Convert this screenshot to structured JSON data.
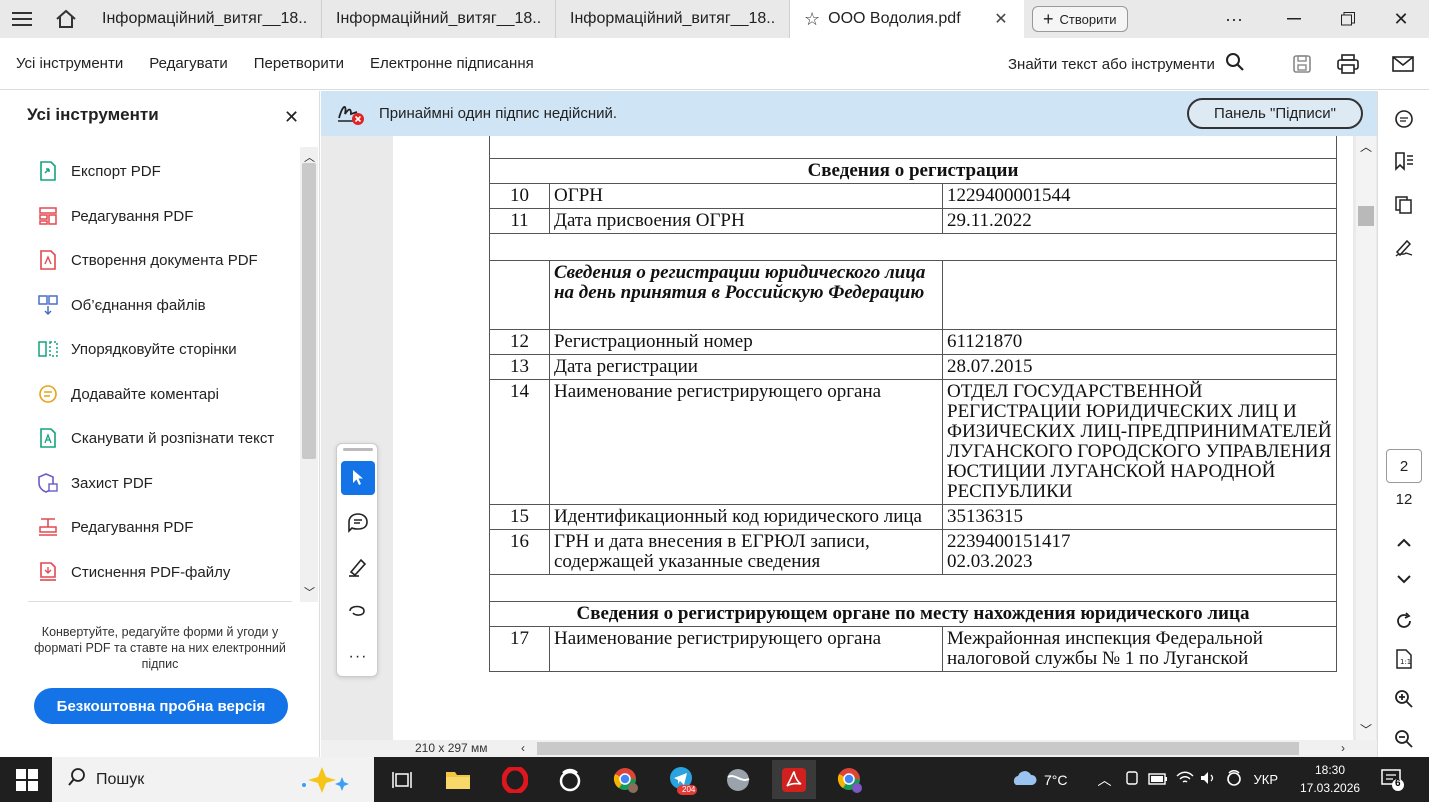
{
  "tabs": [
    {
      "label": "Інформаційний_витяг__18..."
    },
    {
      "label": "Інформаційний_витяг__18..."
    },
    {
      "label": "Інформаційний_витяг__18..."
    },
    {
      "label": "ООО Водолия.pdf",
      "active": true
    }
  ],
  "create_label": "Створити",
  "more_label": "···",
  "menu": {
    "items": [
      "Усі інструменти",
      "Редагувати",
      "Перетворити",
      "Електронне підписання"
    ],
    "find": "Знайти текст або інструменти"
  },
  "left_panel": {
    "title": "Усі інструменти",
    "tools": [
      {
        "label": "Експорт PDF",
        "icon": "export-pdf-icon",
        "color": "#14a37f"
      },
      {
        "label": "Редагування PDF",
        "icon": "edit-pdf-icon",
        "color": "#e34850"
      },
      {
        "label": "Створення документа PDF",
        "icon": "create-pdf-icon",
        "color": "#e34850"
      },
      {
        "label": "Об’єднання файлів",
        "icon": "combine-files-icon",
        "color": "#4b6ec9"
      },
      {
        "label": "Упорядковуйте сторінки",
        "icon": "organize-pages-icon",
        "color": "#14a37f"
      },
      {
        "label": "Додавайте коментарі",
        "icon": "comment-icon",
        "color": "#e8a317"
      },
      {
        "label": "Сканувати й розпізнати текст",
        "icon": "scan-ocr-icon",
        "color": "#14a37f"
      },
      {
        "label": "Захист PDF",
        "icon": "protect-pdf-icon",
        "color": "#6a5acd"
      },
      {
        "label": "Редагування PDF",
        "icon": "redact-pdf-icon",
        "color": "#e34850"
      },
      {
        "label": "Стиснення PDF-файлу",
        "icon": "compress-pdf-icon",
        "color": "#e34850"
      }
    ],
    "promo": "Конвертуйте, редагуйте форми й угоди у форматі PDF та ставте на них електронний підпис",
    "trial_button": "Безкоштовна пробна версія"
  },
  "notice": {
    "text": "Принаймні один підпис недійсний.",
    "button": "Панель \"Підписи\""
  },
  "document": {
    "rows": [
      {
        "type": "section",
        "text": "Сведения о регистрации"
      },
      {
        "type": "row",
        "n": "10",
        "label": "ОГРН",
        "value": "1229400001544"
      },
      {
        "type": "row",
        "n": "11",
        "label": "Дата присвоения ОГРН",
        "value": "29.11.2022"
      },
      {
        "type": "blank"
      },
      {
        "type": "subhead",
        "text": "Сведения о регистрации юридического лица на день принятия в Российскую Федерацию"
      },
      {
        "type": "row",
        "n": "12",
        "label": "Регистрационный номер",
        "value": "61121870"
      },
      {
        "type": "row",
        "n": "13",
        "label": "Дата регистрации",
        "value": "28.07.2015"
      },
      {
        "type": "row",
        "n": "14",
        "label": "Наименование регистрирующего органа",
        "value": "ОТДЕЛ ГОСУДАРСТВЕННОЙ РЕГИСТРАЦИИ ЮРИДИЧЕСКИХ ЛИЦ И ФИЗИЧЕСКИХ ЛИЦ-ПРЕДПРИНИМАТЕЛЕЙ ЛУГАНСКОГО ГОРОДСКОГО УПРАВЛЕНИЯ ЮСТИЦИИ ЛУГАНСКОЙ НАРОДНОЙ РЕСПУБЛИКИ"
      },
      {
        "type": "row",
        "n": "15",
        "label": "Идентификационный код юридического лица",
        "value": "35136315"
      },
      {
        "type": "row",
        "n": "16",
        "label": "ГРН и дата внесения в ЕГРЮЛ записи, содержащей указанные сведения",
        "value": "2239400151417\n02.03.2023"
      },
      {
        "type": "blank"
      },
      {
        "type": "section",
        "text": "Сведения о регистрирующем органе по месту нахождения юридического лица"
      },
      {
        "type": "row",
        "n": "17",
        "label": "Наименование регистрирующего органа",
        "value": "Межрайонная инспекция Федеральной налоговой службы № 1 по Луганской"
      }
    ],
    "page_size": "210 x 297 мм"
  },
  "right_rail": {
    "page_current": "2",
    "page_total": "12"
  },
  "taskbar": {
    "search": "Пошук",
    "temperature": "7°C",
    "language": "УКР",
    "time": "18:30",
    "date": "17.03.2026",
    "telegram_badge": "204",
    "notif_count": "6"
  }
}
